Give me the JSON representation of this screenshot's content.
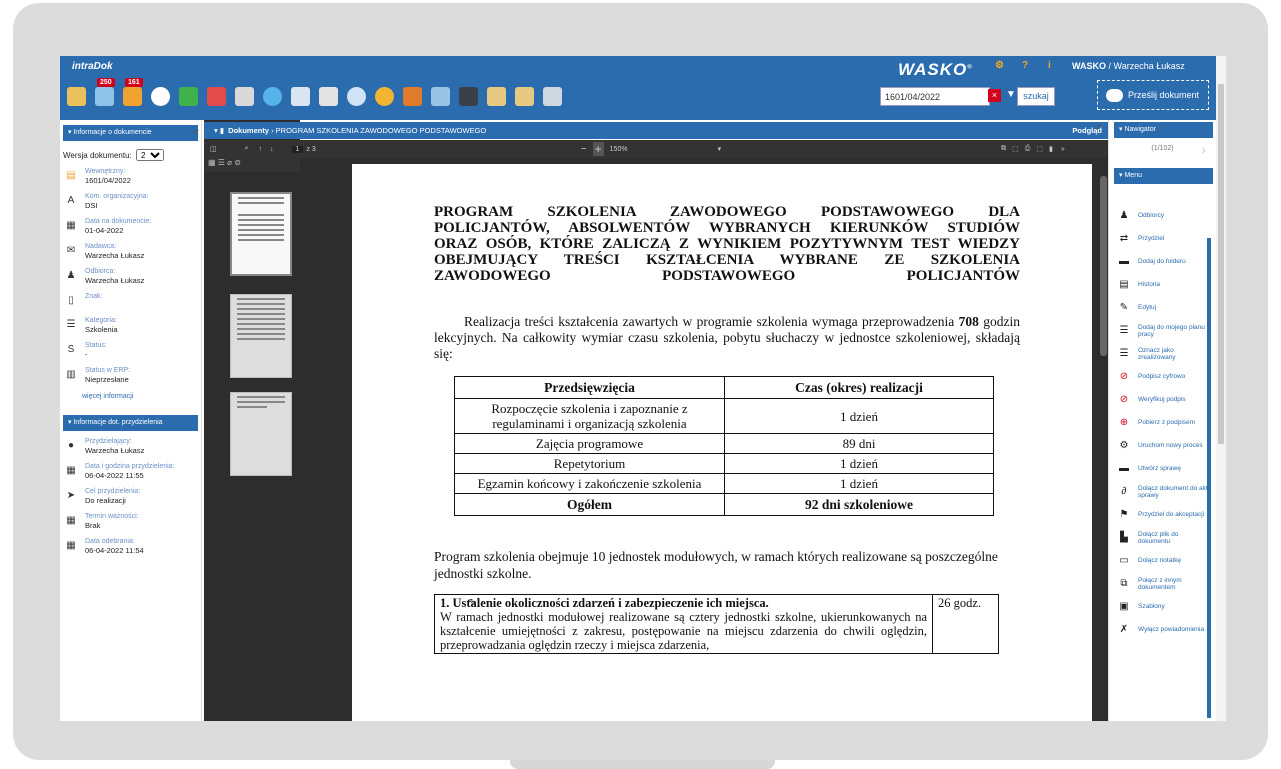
{
  "app": {
    "logo": "intraDok",
    "badge1": "250",
    "badge2": "161",
    "brand": "WASKO",
    "user_prefix": "WASKO",
    "user": "Warzecha Łukasz",
    "doc_number": "1601/04/2022",
    "search_label": "szukaj",
    "upload_label": "Prześlij dokument"
  },
  "left": {
    "section1": "Informacje o dokumencie",
    "version_label": "Wersja dokumentu:",
    "version_value": "2",
    "fields": [
      {
        "label": "Wewnętrzny:",
        "value": "1601/04/2022",
        "icon": "document-icon"
      },
      {
        "label": "Kom. organizacyjna:",
        "value": "DSI",
        "icon": "org-unit-icon"
      },
      {
        "label": "Data na dokumencie:",
        "value": "01-04-2022",
        "icon": "calendar-icon"
      },
      {
        "label": "Nadawca:",
        "value": "Warzecha Łukasz",
        "icon": "mail-icon"
      },
      {
        "label": "Odbiorca:",
        "value": "Warzecha Łukasz",
        "icon": "recipient-icon"
      },
      {
        "label": "Znak:",
        "value": "",
        "icon": "sign-icon"
      },
      {
        "label": "Kategoria:",
        "value": "Szkolenia",
        "icon": "list-icon"
      },
      {
        "label": "Status:",
        "value": "-",
        "icon": "status-icon"
      },
      {
        "label": "Status w ERP:",
        "value": "Nieprzesłane",
        "icon": "erp-icon"
      }
    ],
    "more": "więcej informacji",
    "section2": "Informacje dot. przydzielenia",
    "assign": [
      {
        "label": "Przydzielający:",
        "value": "Warzecha Łukasz",
        "icon": "user-icon"
      },
      {
        "label": "Data i godzina przydzielenia:",
        "value": "06-04-2022 11:55",
        "icon": "calendar-icon"
      },
      {
        "label": "Cel przydzielenia:",
        "value": "Do realizacji",
        "icon": "send-icon"
      },
      {
        "label": "Termin ważności:",
        "value": "Brak",
        "icon": "deadline-icon"
      },
      {
        "label": "Data odebrania:",
        "value": "06-04-2022 11:54",
        "icon": "received-icon"
      }
    ]
  },
  "breadcrumb": {
    "root": "Dokumenty",
    "current": "PROGRAM SZKOLENIA ZAWODOWEGO PODSTAWOWEGO",
    "preview": "Podgląd"
  },
  "pdf": {
    "page": "1",
    "pages": "z 3",
    "zoom": "150%"
  },
  "doc": {
    "title": [
      "PROGRAM SZKOLENIA ZAWODOWEGO PODSTAWOWEGO DLA",
      "POLICJANTÓW, ABSOLWENTÓW WYBRANYCH KIERUNKÓW STUDIÓW",
      "ORAZ OSÓB, KTÓRE ZALICZĄ Z WYNIKIEM POZYTYWNYM TEST WIEDZY",
      "OBEJMUJĄCY TREŚCI KSZTAŁCENIA WYBRANE ZE SZKOLENIA",
      "ZAWODOWEGO PODSTAWOWEGO POLICJANTÓW"
    ],
    "para_a": "Realizacja treści kształcenia zawartych w programie szkolenia wymaga przeprowadzenia ",
    "para_hours": "708",
    "para_b": " godzin lekcyjnych. Na całkowity wymiar czasu szkolenia, pobytu słuchaczy w jednostce szkoleniowej, składają się:",
    "table_head": [
      "Przedsięwzięcia",
      "Czas (okres) realizacji"
    ],
    "table_rows": [
      [
        "Rozpoczęcie szkolenia i zapoznanie z regulaminami i organizacją szkolenia",
        "1 dzień"
      ],
      [
        "Zajęcia programowe",
        "89 dni"
      ],
      [
        "Repetytorium",
        "1 dzień"
      ],
      [
        "Egzamin końcowy i zakończenie szkolenia",
        "1 dzień"
      ]
    ],
    "table_total": [
      "Ogółem",
      "92 dni szkoleniowe"
    ],
    "para2": "Program szkolenia obejmuje 10 jednostek modułowych, w ramach których realizowane są poszczególne jednostki szkolne.",
    "module_title": "1. Ustalenie okoliczności zdarzeń i zabezpieczenie ich miejsca.",
    "module_hours": "26 godz.",
    "module_text": "W ramach jednostki modułowej realizowane są cztery jednostki szkolne, ukierunkowanych na kształcenie umiejętności z zakresu, postępowanie na miejscu zdarzenia do chwili oględzin, przeprowadzania oględzin rzeczy i miejsca zdarzenia,"
  },
  "right": {
    "navigator": "Nawigator",
    "nav_count": "(1/102)",
    "menu": "Menu",
    "items": [
      {
        "label": "Odbiorcy",
        "icon": "recipients-icon"
      },
      {
        "label": "Przydziel",
        "icon": "assign-icon"
      },
      {
        "label": "Dodaj do folderu",
        "icon": "folder-add-icon"
      },
      {
        "label": "Historia",
        "icon": "history-icon"
      },
      {
        "label": "Edytuj",
        "icon": "edit-icon"
      },
      {
        "label": "Dodaj do mojego planu pracy",
        "icon": "plan-add-icon"
      },
      {
        "label": "Oznacz jako zrealizowany",
        "icon": "mark-done-icon"
      },
      {
        "label": "Podpisz cyfrowo",
        "icon": "sign-digital-icon"
      },
      {
        "label": "Weryfikuj podpis",
        "icon": "verify-signature-icon"
      },
      {
        "label": "Pobierz z podpisem",
        "icon": "download-signed-icon"
      },
      {
        "label": "Uruchom nowy proces",
        "icon": "process-icon"
      },
      {
        "label": "Utwórz sprawę",
        "icon": "case-icon"
      },
      {
        "label": "Dołącz dokument do akt sprawy",
        "icon": "attach-case-icon"
      },
      {
        "label": "Przydziel do akceptacji",
        "icon": "flag-icon"
      },
      {
        "label": "Dołącz plik do dokumentu",
        "icon": "attach-file-icon"
      },
      {
        "label": "Dołącz notatkę",
        "icon": "note-icon"
      },
      {
        "label": "Połącz z innym dokumentem",
        "icon": "link-doc-icon"
      },
      {
        "label": "Szablony",
        "icon": "template-icon"
      },
      {
        "label": "Wyłącz powiadomienia",
        "icon": "bell-off-icon"
      }
    ]
  }
}
